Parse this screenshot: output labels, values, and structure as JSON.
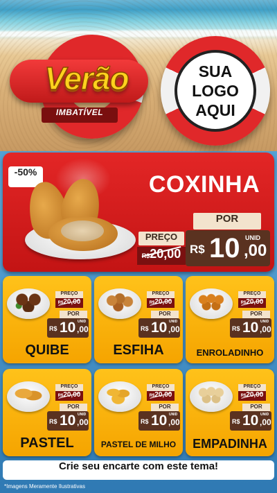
{
  "header": {
    "badge_title": "Verão",
    "badge_subtitle": "IMBATÍVEL",
    "logo_lines": [
      "SUA",
      "LOGO",
      "AQUI"
    ]
  },
  "hero": {
    "discount": "-50%",
    "name": "COXINHA",
    "preco_label": "PREÇO",
    "old_price_currency": "R$",
    "old_price": "20,00",
    "por_label": "POR",
    "currency": "R$",
    "price_int": "10",
    "price_dec": ",00",
    "unit": "UNID"
  },
  "products": [
    {
      "name": "QUIBE",
      "preco_label": "PREÇO",
      "old_currency": "R$",
      "old_price": "20,00",
      "por_label": "POR",
      "currency": "R$",
      "price_int": "10",
      "price_dec": ",00",
      "unit": "UNID"
    },
    {
      "name": "ESFIHA",
      "preco_label": "PREÇO",
      "old_currency": "R$",
      "old_price": "20,00",
      "por_label": "POR",
      "currency": "R$",
      "price_int": "10",
      "price_dec": ",00",
      "unit": "UNID"
    },
    {
      "name": "ENROLADINHO",
      "preco_label": "PREÇO",
      "old_currency": "R$",
      "old_price": "20,00",
      "por_label": "POR",
      "currency": "R$",
      "price_int": "10",
      "price_dec": ",00",
      "unit": "UNID"
    },
    {
      "name": "PASTEL",
      "preco_label": "PREÇO",
      "old_currency": "R$",
      "old_price": "20,00",
      "por_label": "POR",
      "currency": "R$",
      "price_int": "10",
      "price_dec": ",00",
      "unit": "UNID"
    },
    {
      "name": "PASTEL DE MILHO",
      "preco_label": "PREÇO",
      "old_currency": "R$",
      "old_price": "20,00",
      "por_label": "POR",
      "currency": "R$",
      "price_int": "10",
      "price_dec": ",00",
      "unit": "UNID"
    },
    {
      "name": "EMPADINHA",
      "preco_label": "PREÇO",
      "old_currency": "R$",
      "old_price": "20,00",
      "por_label": "POR",
      "currency": "R$",
      "price_int": "10",
      "price_dec": ",00",
      "unit": "UNID"
    }
  ],
  "footer": {
    "cta": "Crie seu encarte com este tema!",
    "disclaimer": "*Imagens Meramente Ilustrativas"
  },
  "colors": {
    "hero_red": "#e32626",
    "card_yellow": "#ffc21a",
    "price_brown": "#5a3220",
    "old_price_red": "#7a1010",
    "badge_gold": "#ffd21e"
  }
}
